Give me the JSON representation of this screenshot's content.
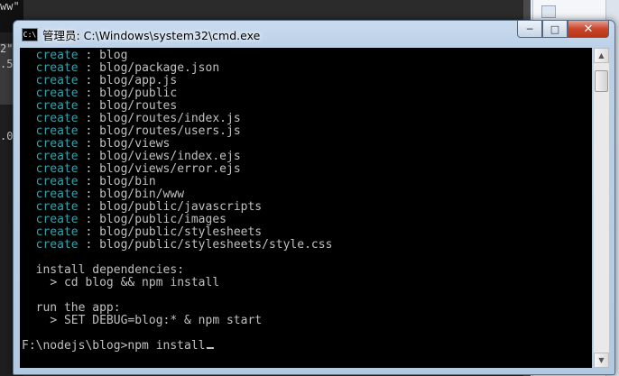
{
  "window": {
    "title": "管理员: C:\\Windows\\system32\\cmd.exe",
    "icon": "cmd-icon",
    "controls": {
      "minimize": "─",
      "maximize": "□",
      "close": "✕"
    }
  },
  "console": {
    "create_lines": [
      {
        "keyword": "create",
        "sep": " : ",
        "path": "blog"
      },
      {
        "keyword": "create",
        "sep": " : ",
        "path": "blog/package.json"
      },
      {
        "keyword": "create",
        "sep": " : ",
        "path": "blog/app.js"
      },
      {
        "keyword": "create",
        "sep": " : ",
        "path": "blog/public"
      },
      {
        "keyword": "create",
        "sep": " : ",
        "path": "blog/routes"
      },
      {
        "keyword": "create",
        "sep": " : ",
        "path": "blog/routes/index.js"
      },
      {
        "keyword": "create",
        "sep": " : ",
        "path": "blog/routes/users.js"
      },
      {
        "keyword": "create",
        "sep": " : ",
        "path": "blog/views"
      },
      {
        "keyword": "create",
        "sep": " : ",
        "path": "blog/views/index.ejs"
      },
      {
        "keyword": "create",
        "sep": " : ",
        "path": "blog/views/error.ejs"
      },
      {
        "keyword": "create",
        "sep": " : ",
        "path": "blog/bin"
      },
      {
        "keyword": "create",
        "sep": " : ",
        "path": "blog/bin/www"
      },
      {
        "keyword": "create",
        "sep": " : ",
        "path": "blog/public/javascripts"
      },
      {
        "keyword": "create",
        "sep": " : ",
        "path": "blog/public/images"
      },
      {
        "keyword": "create",
        "sep": " : ",
        "path": "blog/public/stylesheets"
      },
      {
        "keyword": "create",
        "sep": " : ",
        "path": "blog/public/stylesheets/style.css"
      }
    ],
    "install_heading": "install dependencies:",
    "install_cmd": "> cd blog && npm install",
    "run_heading": "run the app:",
    "run_cmd": "> SET DEBUG=blog:* & npm start",
    "prompt": "F:\\nodejs\\blog>npm install"
  },
  "background": {
    "fragments": [
      "ww\"",
      "2\"",
      ".5",
      ".0"
    ]
  },
  "colors": {
    "console_bg": "#000000",
    "console_text": "#c0c0c0",
    "keyword": "#3aa0a8",
    "close_button": "#c9462c"
  }
}
